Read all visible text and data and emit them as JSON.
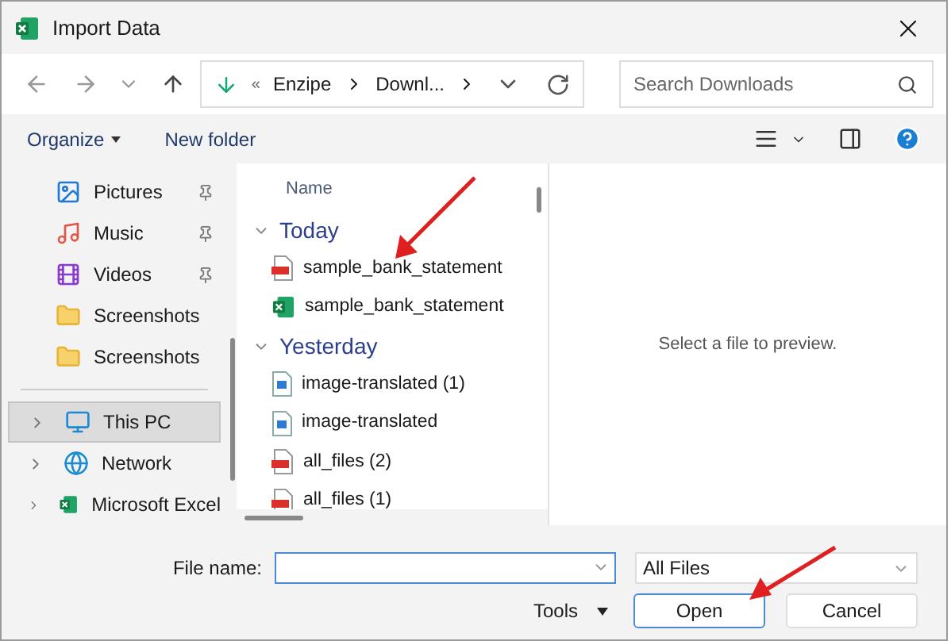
{
  "window": {
    "title": "Import Data"
  },
  "address": {
    "crumbs": [
      "Enzipe",
      "Downl..."
    ],
    "overflow": "«"
  },
  "search": {
    "placeholder": "Search Downloads"
  },
  "toolbar": {
    "organize": "Organize",
    "new_folder": "New folder"
  },
  "sidebar": {
    "quick": [
      {
        "label": "Pictures",
        "kind": "pictures",
        "pinned": true
      },
      {
        "label": "Music",
        "kind": "music",
        "pinned": true
      },
      {
        "label": "Videos",
        "kind": "videos",
        "pinned": true
      },
      {
        "label": "Screenshots",
        "kind": "folder",
        "pinned": false
      },
      {
        "label": "Screenshots",
        "kind": "folder",
        "pinned": false
      }
    ],
    "roots": [
      {
        "label": "This PC",
        "kind": "pc",
        "selected": true
      },
      {
        "label": "Network",
        "kind": "network",
        "selected": false
      },
      {
        "label": "Microsoft Excel",
        "kind": "excel",
        "selected": false
      }
    ]
  },
  "files": {
    "column": "Name",
    "groups": [
      {
        "label": "Today",
        "expanded": true,
        "items": [
          {
            "name": "sample_bank_statement",
            "kind": "pdf"
          },
          {
            "name": "sample_bank_statement",
            "kind": "excel"
          }
        ]
      },
      {
        "label": "Yesterday",
        "expanded": true,
        "items": [
          {
            "name": "image-translated (1)",
            "kind": "image"
          },
          {
            "name": "image-translated",
            "kind": "image"
          },
          {
            "name": "all_files (2)",
            "kind": "pdf"
          },
          {
            "name": "all_files (1)",
            "kind": "pdf"
          }
        ]
      }
    ]
  },
  "preview": {
    "message": "Select a file to preview."
  },
  "bottom": {
    "file_name_label": "File name:",
    "filter": "All Files",
    "tools": "Tools",
    "open": "Open",
    "cancel": "Cancel"
  }
}
